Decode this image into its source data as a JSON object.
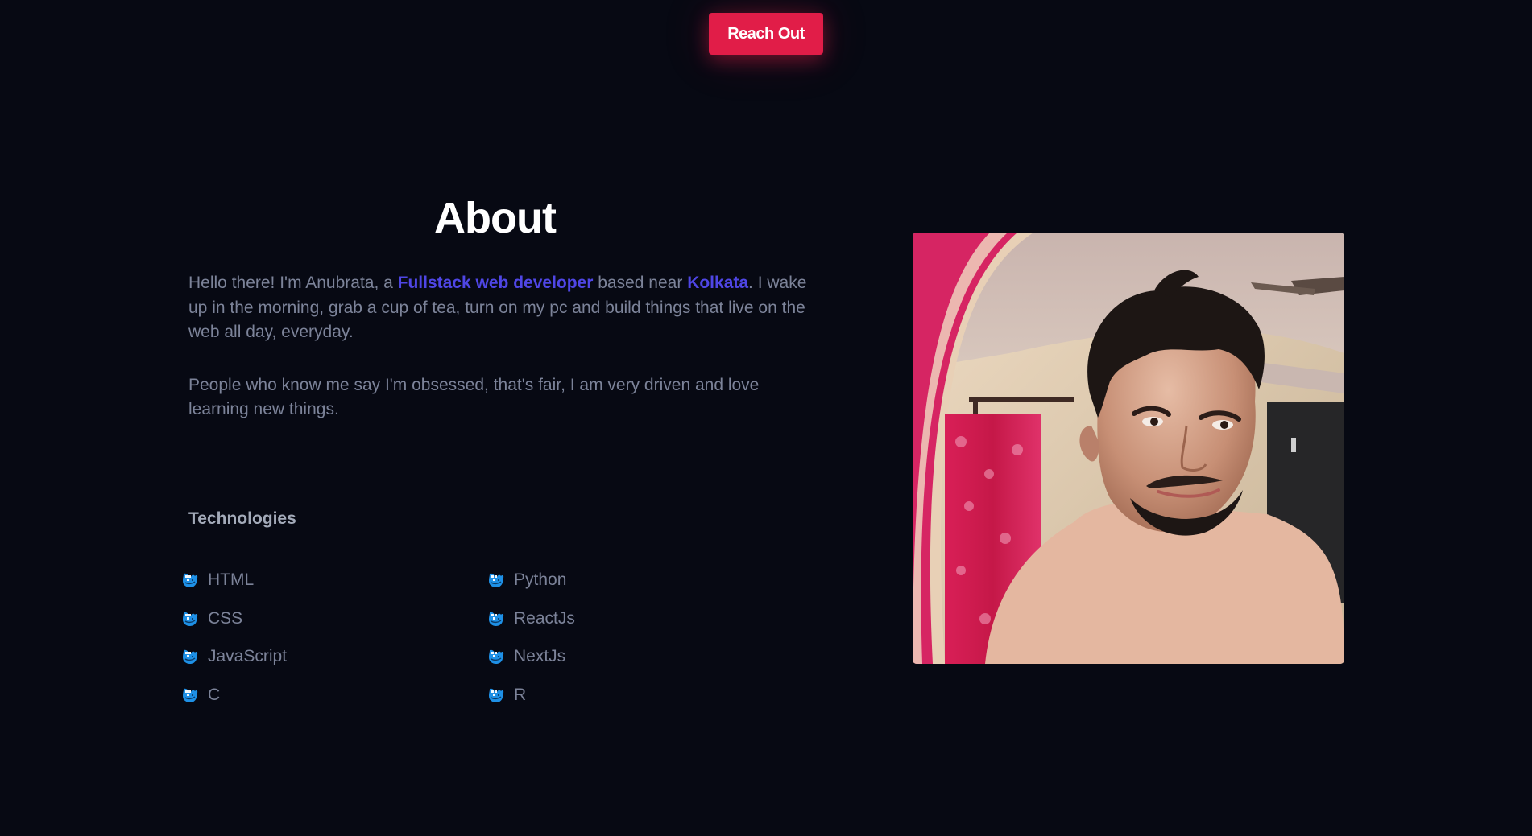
{
  "cta": {
    "label": "Reach Out"
  },
  "about": {
    "title": "About",
    "bio1": {
      "before": "Hello there! I'm Anubrata, a ",
      "role": "Fullstack web developer",
      "middle": " based near ",
      "location": "Kolkata",
      "after": ". I wake up in the morning, grab a cup of tea, turn on my pc and build things that live on the web all day, everyday."
    },
    "bio2": "People who know me say I'm obsessed, that's fair, I am very driven and love learning new things.",
    "highlight_color": "#4f46e5"
  },
  "technologies": {
    "title": "Technologies",
    "column1": [
      "HTML",
      "CSS",
      "JavaScript",
      "C"
    ],
    "column2": [
      "Python",
      "ReactJs",
      "NextJs",
      "R"
    ],
    "icon": "docker-whale-icon"
  },
  "colors": {
    "background": "#070913",
    "accent": "#e11d48"
  }
}
